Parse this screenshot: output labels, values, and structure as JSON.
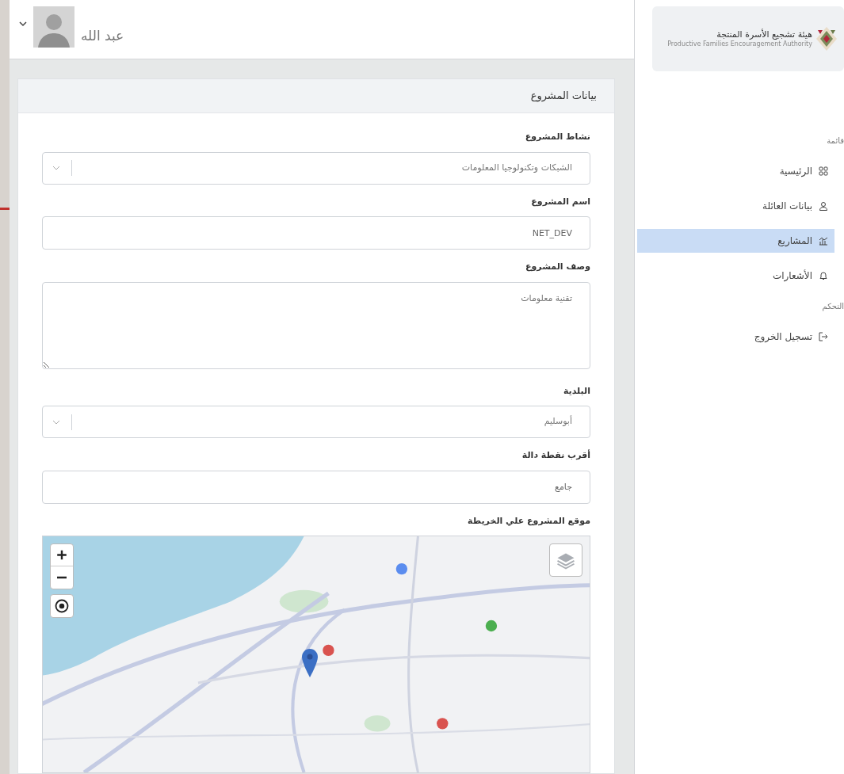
{
  "user": {
    "name": "عبد الله"
  },
  "logo": {
    "title": "هيئة تشجيع الأسرة المنتجة",
    "subtitle": "Productive Families Encouragement Authority"
  },
  "sidebar": {
    "sections": [
      {
        "title": "قائمة",
        "items": [
          {
            "label": "الرئيسية",
            "kind": "grid",
            "selected": false
          },
          {
            "label": "بيانات العائلة",
            "kind": "user",
            "selected": false
          },
          {
            "label": "المشاريع",
            "kind": "chart",
            "selected": true
          },
          {
            "label": "الأشعارات",
            "kind": "bell",
            "selected": false
          }
        ]
      },
      {
        "title": "التحكم",
        "items": [
          {
            "label": "تسجيل الخروج",
            "kind": "logout",
            "selected": false
          }
        ]
      }
    ]
  },
  "card": {
    "title": "بيانات المشروع",
    "fields": [
      {
        "kind": "select",
        "label": "نشاط المشروع",
        "value": "الشبكات وتكنولوجيا المعلومات"
      },
      {
        "kind": "input",
        "label": "اسم المشروع",
        "value": "NET_DEV"
      },
      {
        "kind": "textarea",
        "label": "وصف المشروع",
        "value": "تقنية معلومات"
      },
      {
        "kind": "select",
        "label": "البلدية",
        "value": "أبوسليم"
      },
      {
        "kind": "input",
        "label": "أقرب نقطة دالة",
        "value": "جامع"
      },
      {
        "kind": "map",
        "label": "موقع المشروع علي الخريطة"
      }
    ]
  }
}
